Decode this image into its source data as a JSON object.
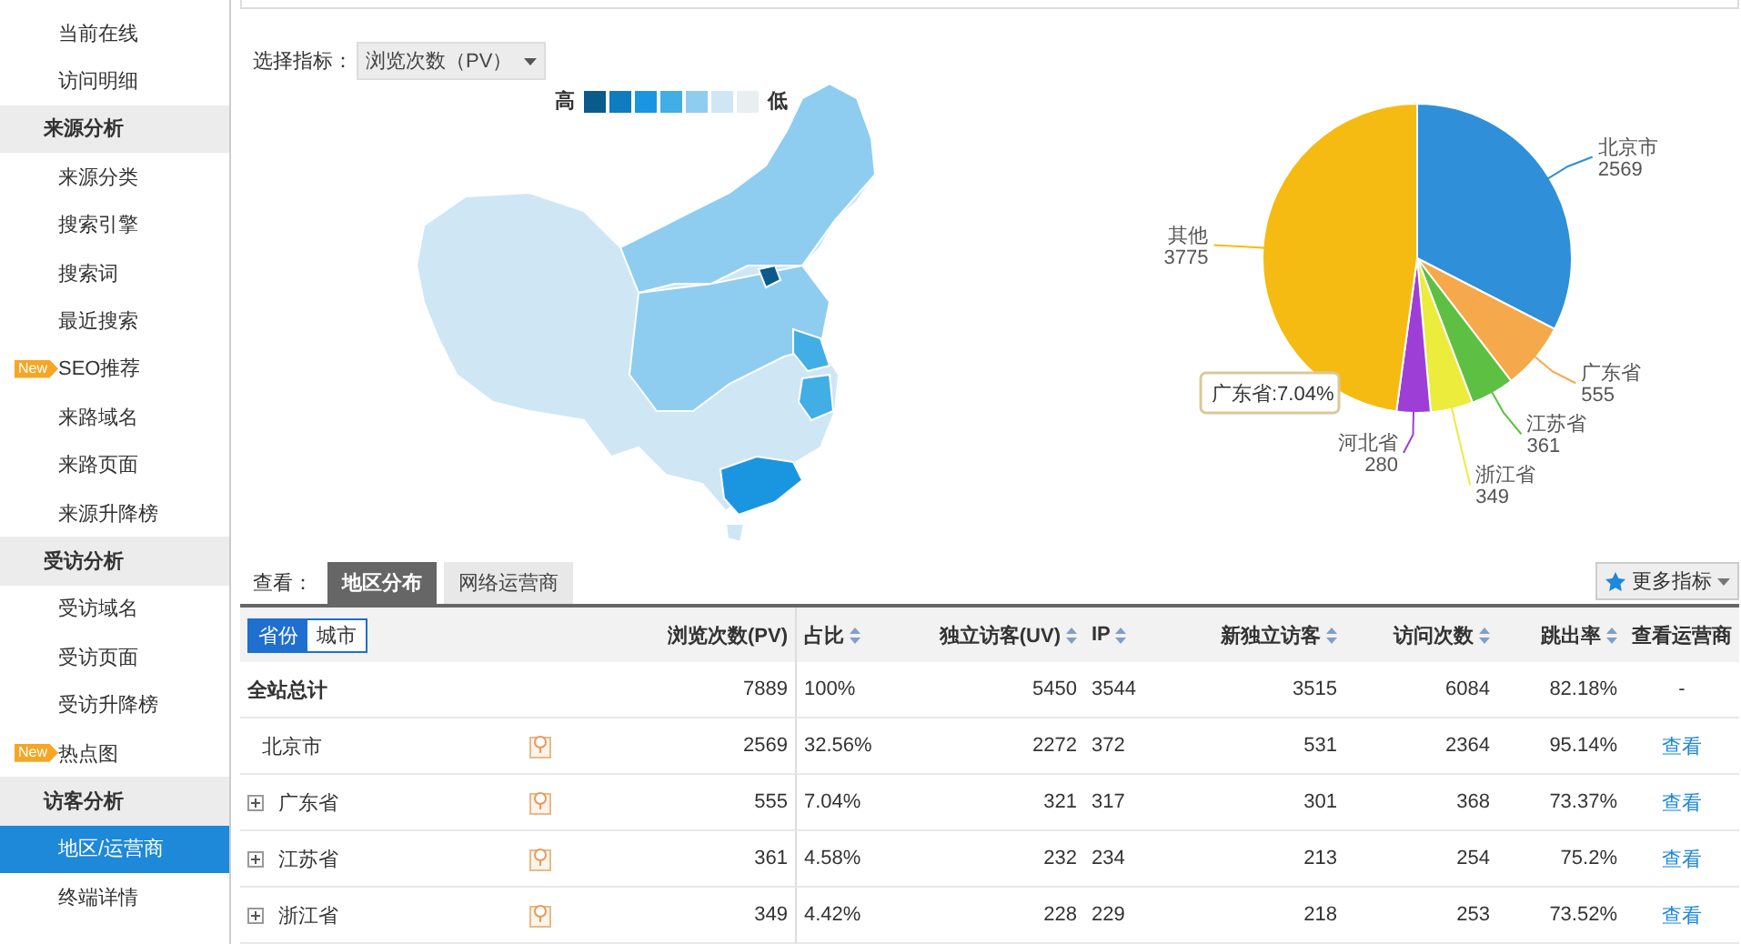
{
  "sidebar": {
    "items": [
      {
        "kind": "item",
        "label": "当前在线",
        "selected": false
      },
      {
        "kind": "item",
        "label": "访问明细",
        "selected": false
      },
      {
        "kind": "header",
        "label": "来源分析",
        "selected": false
      },
      {
        "kind": "item",
        "label": "来源分类",
        "selected": false
      },
      {
        "kind": "item",
        "label": "搜索引擎",
        "selected": false
      },
      {
        "kind": "item",
        "label": "搜索词",
        "selected": false
      },
      {
        "kind": "item",
        "label": "最近搜索",
        "selected": false
      },
      {
        "kind": "item",
        "label": "SEO推荐",
        "selected": false,
        "badge": "New"
      },
      {
        "kind": "item",
        "label": "来路域名",
        "selected": false
      },
      {
        "kind": "item",
        "label": "来路页面",
        "selected": false
      },
      {
        "kind": "item",
        "label": "来源升降榜",
        "selected": false
      },
      {
        "kind": "header",
        "label": "受访分析",
        "selected": false
      },
      {
        "kind": "item",
        "label": "受访域名",
        "selected": false
      },
      {
        "kind": "item",
        "label": "受访页面",
        "selected": false
      },
      {
        "kind": "item",
        "label": "受访升降榜",
        "selected": false
      },
      {
        "kind": "item",
        "label": "热点图",
        "selected": false,
        "badge": "New"
      },
      {
        "kind": "header",
        "label": "访客分析",
        "selected": false
      },
      {
        "kind": "item",
        "label": "地区/运营商",
        "selected": true
      },
      {
        "kind": "item",
        "label": "终端详情",
        "selected": false
      }
    ]
  },
  "metric_select": {
    "label": "选择指标：",
    "value": "浏览次数（PV）"
  },
  "legend": {
    "high": "高",
    "low": "低",
    "swatches": [
      {
        "color": "#0b5a8c"
      },
      {
        "color": "#0f7bc0"
      },
      {
        "color": "#1a96e0"
      },
      {
        "color": "#41aee6"
      },
      {
        "color": "#8ecdf0"
      },
      {
        "color": "#cfe6f5"
      },
      {
        "color": "#e9eef1"
      }
    ]
  },
  "pie": {
    "tooltip": "广东省:7.04%",
    "chart_data": {
      "type": "pie",
      "categories": [
        "北京市",
        "广东省",
        "江苏省",
        "浙江省",
        "河北省",
        "其他"
      ],
      "values": [
        2569,
        555,
        361,
        349,
        280,
        3775
      ],
      "colors": [
        "#2f8fd8",
        "#f5a94a",
        "#5ec043",
        "#ecec3c",
        "#9d3fd6",
        "#f5bb12"
      ],
      "data_labels": true
    }
  },
  "view": {
    "label": "查看：",
    "tabs": [
      {
        "label": "地区分布",
        "selected": true
      },
      {
        "label": "网络运营商",
        "selected": false
      }
    ],
    "more_button": "更多指标"
  },
  "table": {
    "region_toggle": [
      {
        "label": "省份",
        "selected": true
      },
      {
        "label": "城市",
        "selected": false
      }
    ],
    "columns": [
      {
        "label": "浏览次数(PV)",
        "sortable": false
      },
      {
        "label": "占比",
        "sortable": true
      },
      {
        "label": "独立访客(UV)",
        "sortable": true
      },
      {
        "label": "IP",
        "sortable": true
      },
      {
        "label": "新独立访客",
        "sortable": true
      },
      {
        "label": "访问次数",
        "sortable": true
      },
      {
        "label": "跳出率",
        "sortable": true
      },
      {
        "label": "查看运营商",
        "sortable": false
      }
    ],
    "total": {
      "name": "全站总计",
      "values": [
        "7889",
        "100%",
        "5450",
        "3544",
        "3515",
        "6084",
        "82.18%"
      ],
      "operator": "-"
    },
    "rows": [
      {
        "name": "北京市",
        "expandable": false,
        "values": [
          "2569",
          "32.56%",
          "2272",
          "372",
          "531",
          "2364",
          "95.14%"
        ],
        "operator_link": "查看"
      },
      {
        "name": "广东省",
        "expandable": true,
        "values": [
          "555",
          "7.04%",
          "321",
          "317",
          "301",
          "368",
          "73.37%"
        ],
        "operator_link": "查看"
      },
      {
        "name": "江苏省",
        "expandable": true,
        "values": [
          "361",
          "4.58%",
          "232",
          "234",
          "213",
          "254",
          "75.2%"
        ],
        "operator_link": "查看"
      },
      {
        "name": "浙江省",
        "expandable": true,
        "values": [
          "349",
          "4.42%",
          "228",
          "229",
          "218",
          "253",
          "73.52%"
        ],
        "operator_link": "查看"
      }
    ]
  }
}
